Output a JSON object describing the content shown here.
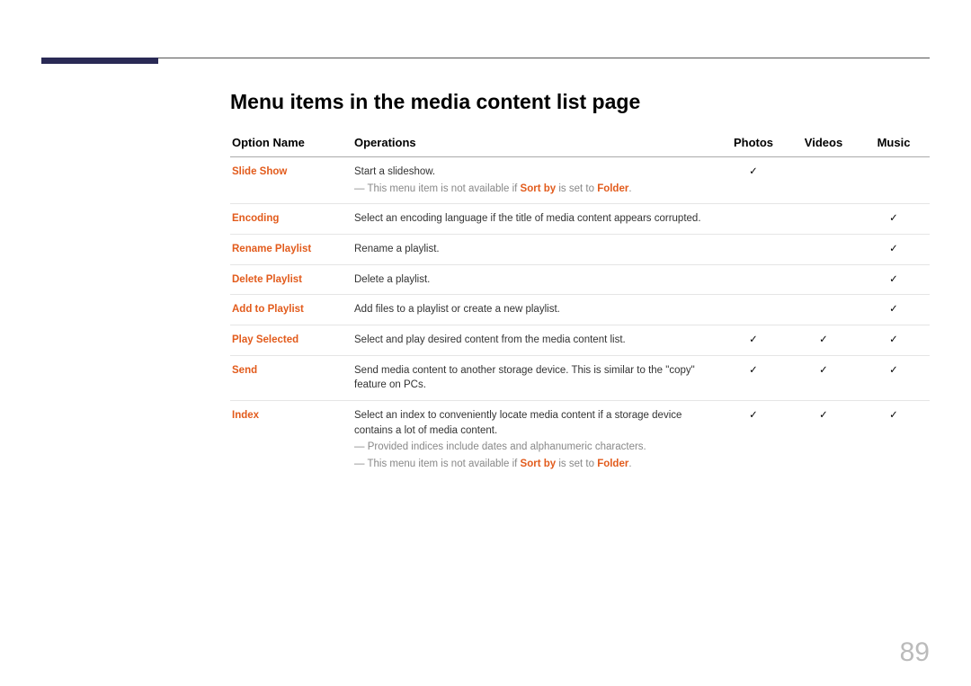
{
  "page": {
    "number": "89",
    "heading": "Menu items in the media content list page"
  },
  "headers": {
    "option": "Option Name",
    "operations": "Operations",
    "photos": "Photos",
    "videos": "Videos",
    "music": "Music"
  },
  "tick": "✓",
  "rows": [
    {
      "name": "Slide Show",
      "op": "Start a slideshow.",
      "note_parts": [
        "This menu item is not available if ",
        "Sort by",
        " is set to ",
        "Folder",
        "."
      ],
      "photos": true,
      "videos": false,
      "music": false
    },
    {
      "name": "Encoding",
      "op": "Select an encoding language if the title of media content appears corrupted.",
      "photos": false,
      "videos": false,
      "music": true
    },
    {
      "name": "Rename Playlist",
      "op": "Rename a playlist.",
      "photos": false,
      "videos": false,
      "music": true
    },
    {
      "name": "Delete Playlist",
      "op": "Delete a playlist.",
      "photos": false,
      "videos": false,
      "music": true
    },
    {
      "name": "Add to Playlist",
      "op": "Add files to a playlist or create a new playlist.",
      "photos": false,
      "videos": false,
      "music": true
    },
    {
      "name": "Play Selected",
      "op": "Select and play desired content from the media content list.",
      "photos": true,
      "videos": true,
      "music": true
    },
    {
      "name": "Send",
      "op": "Send media content to another storage device. This is similar to the \"copy\" feature on PCs.",
      "photos": true,
      "videos": true,
      "music": true
    },
    {
      "name": "Index",
      "op": "Select an index to conveniently locate media content if a storage device contains a lot of media content.",
      "note_plain": "Provided indices include dates and alphanumeric characters.",
      "note_parts": [
        "This menu item is not available if ",
        "Sort by",
        " is set to ",
        "Folder",
        "."
      ],
      "photos": true,
      "videos": true,
      "music": true
    }
  ]
}
